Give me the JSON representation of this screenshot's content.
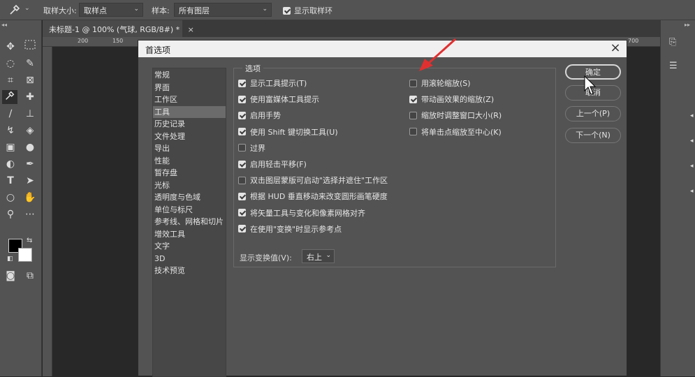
{
  "optbar": {
    "tool_icon": "eyedropper-icon",
    "sample_size_label": "取样大小:",
    "sample_size_value": "取样点",
    "sample_label": "样本:",
    "sample_value": "所有图层",
    "show_ring_label": "显示取样环",
    "show_ring_checked": true
  },
  "document": {
    "tab_title": "未标题-1 @ 100% (气球, RGB/8#) *",
    "tab_close": "×",
    "ruler_numbers": [
      "200",
      "150"
    ],
    "ruler_right": "700"
  },
  "dialog": {
    "title": "首选项",
    "close": "×",
    "categories": [
      "常规",
      "界面",
      "工作区",
      "工具",
      "历史记录",
      "文件处理",
      "导出",
      "性能",
      "暂存盘",
      "光标",
      "透明度与色域",
      "单位与标尺",
      "参考线、网格和切片",
      "增效工具",
      "文字",
      "3D",
      "技术预览"
    ],
    "selected_category": "工具",
    "group_label": "选项",
    "left_options": [
      {
        "label": "显示工具提示(T)",
        "checked": true
      },
      {
        "label": "使用富媒体工具提示",
        "checked": true
      },
      {
        "label": "启用手势",
        "checked": true
      },
      {
        "label": "使用 Shift 键切换工具(U)",
        "checked": true
      },
      {
        "label": "过界",
        "checked": false
      },
      {
        "label": "启用轻击平移(F)",
        "checked": true
      },
      {
        "label": "双击图层蒙版可启动\"选择并遮住\"工作区",
        "checked": false
      },
      {
        "label": "根据 HUD 垂直移动来改变圆形画笔硬度",
        "checked": true
      },
      {
        "label": "将矢量工具与变化和像素网格对齐",
        "checked": true
      },
      {
        "label": "在使用\"变换\"时显示参考点",
        "checked": true
      }
    ],
    "right_options": [
      {
        "label": "用滚轮缩放(S)",
        "checked": false
      },
      {
        "label": "带动画效果的缩放(Z)",
        "checked": true
      },
      {
        "label": "缩放时调整窗口大小(R)",
        "checked": false
      },
      {
        "label": "将单击点缩放至中心(K)",
        "checked": false
      }
    ],
    "transform_label": "显示变换值(V):",
    "transform_value": "右上",
    "buttons": {
      "ok": "确定",
      "cancel": "取消",
      "prev": "上一个(P)",
      "next": "下一个(N)"
    }
  },
  "colors": {
    "accent_arrow": "#e03030",
    "foreground_swatch": "#000000",
    "background_swatch": "#ffffff"
  }
}
